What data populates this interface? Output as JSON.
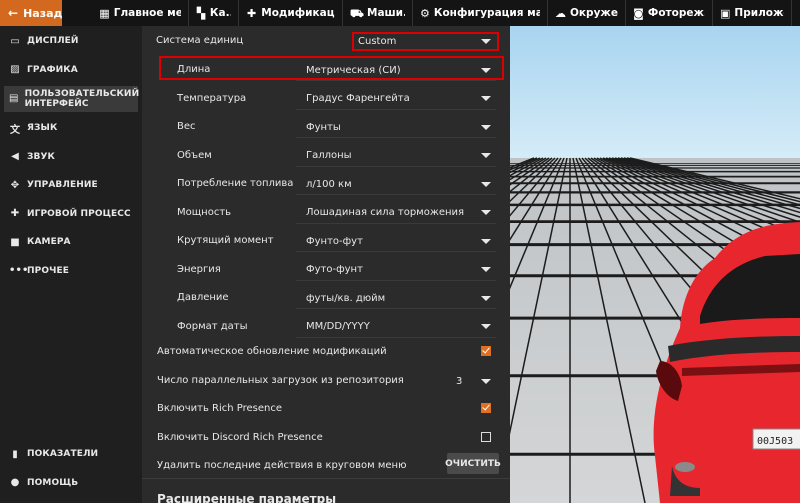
{
  "topbar": {
    "back_label": "Назад",
    "tabs": [
      {
        "icon": "grid-icon",
        "label": "Главное ме..."
      },
      {
        "icon": "map-icon",
        "label": "Ка..."
      },
      {
        "icon": "puzzle-icon",
        "label": "Модификац..."
      },
      {
        "icon": "car-icon",
        "label": "Маши..."
      },
      {
        "icon": "car-wrench-icon",
        "label": "Конфигурация маши..."
      },
      {
        "icon": "weather-icon",
        "label": "Окружен..."
      },
      {
        "icon": "camera-icon",
        "label": "Фотореж..."
      },
      {
        "icon": "window-icon",
        "label": "Приложен"
      }
    ]
  },
  "sidebar": {
    "items": [
      {
        "icon": "monitor-icon",
        "label": "Дисплей"
      },
      {
        "icon": "image-icon",
        "label": "Графика"
      },
      {
        "icon": "ui-icon",
        "label": "Пользовательский интерфейс"
      },
      {
        "icon": "language-icon",
        "label": "Язык"
      },
      {
        "icon": "speaker-icon",
        "label": "Звук"
      },
      {
        "icon": "gamepad-icon",
        "label": "Управление"
      },
      {
        "icon": "puzzle-icon",
        "label": "Игровой процесс"
      },
      {
        "icon": "video-camera-icon",
        "label": "Камера"
      },
      {
        "icon": "dots-icon",
        "label": "Прочее"
      }
    ],
    "bottom_items": [
      {
        "icon": "chart-icon",
        "label": "Показатели"
      },
      {
        "icon": "help-icon",
        "label": "Помощь"
      }
    ],
    "active_index": 2
  },
  "settings": {
    "unit_system": {
      "label": "Система единиц",
      "value": "Custom"
    },
    "units": [
      {
        "label": "Длина",
        "value": "Метрическая (СИ)"
      },
      {
        "label": "Температура",
        "value": "Градус Фаренгейта"
      },
      {
        "label": "Вес",
        "value": "Фунты"
      },
      {
        "label": "Объем",
        "value": "Галлоны"
      },
      {
        "label": "Потребление топлива",
        "value": "л/100 км"
      },
      {
        "label": "Мощность",
        "value": "Лошадиная сила торможения"
      },
      {
        "label": "Крутящий момент",
        "value": "Фунто-фут"
      },
      {
        "label": "Энергия",
        "value": "Футо-фунт"
      },
      {
        "label": "Давление",
        "value": "футы/кв. дюйм"
      },
      {
        "label": "Формат даты",
        "value": "MM/DD/YYYY"
      }
    ],
    "auto_update_mods": {
      "label": "Автоматическое обновление модификаций",
      "checked": true
    },
    "parallel_downloads": {
      "label": "Число параллельных загрузок из репозитория",
      "value": "3"
    },
    "rich_presence": {
      "label": "Включить Rich Presence",
      "checked": true
    },
    "discord_rich_presence": {
      "label": "Включить Discord Rich Presence",
      "checked": false
    },
    "clear_radial": {
      "label": "Удалить последние действия в круговом меню",
      "button": "ОЧИСТИТЬ"
    },
    "advanced_title": "Расширенные параметры"
  },
  "view": {
    "license_plate": "00J503"
  },
  "colors": {
    "accent": "#d2691e",
    "checkbox": "#e07020",
    "highlight": "#dd0000",
    "car": "#e8262e"
  }
}
